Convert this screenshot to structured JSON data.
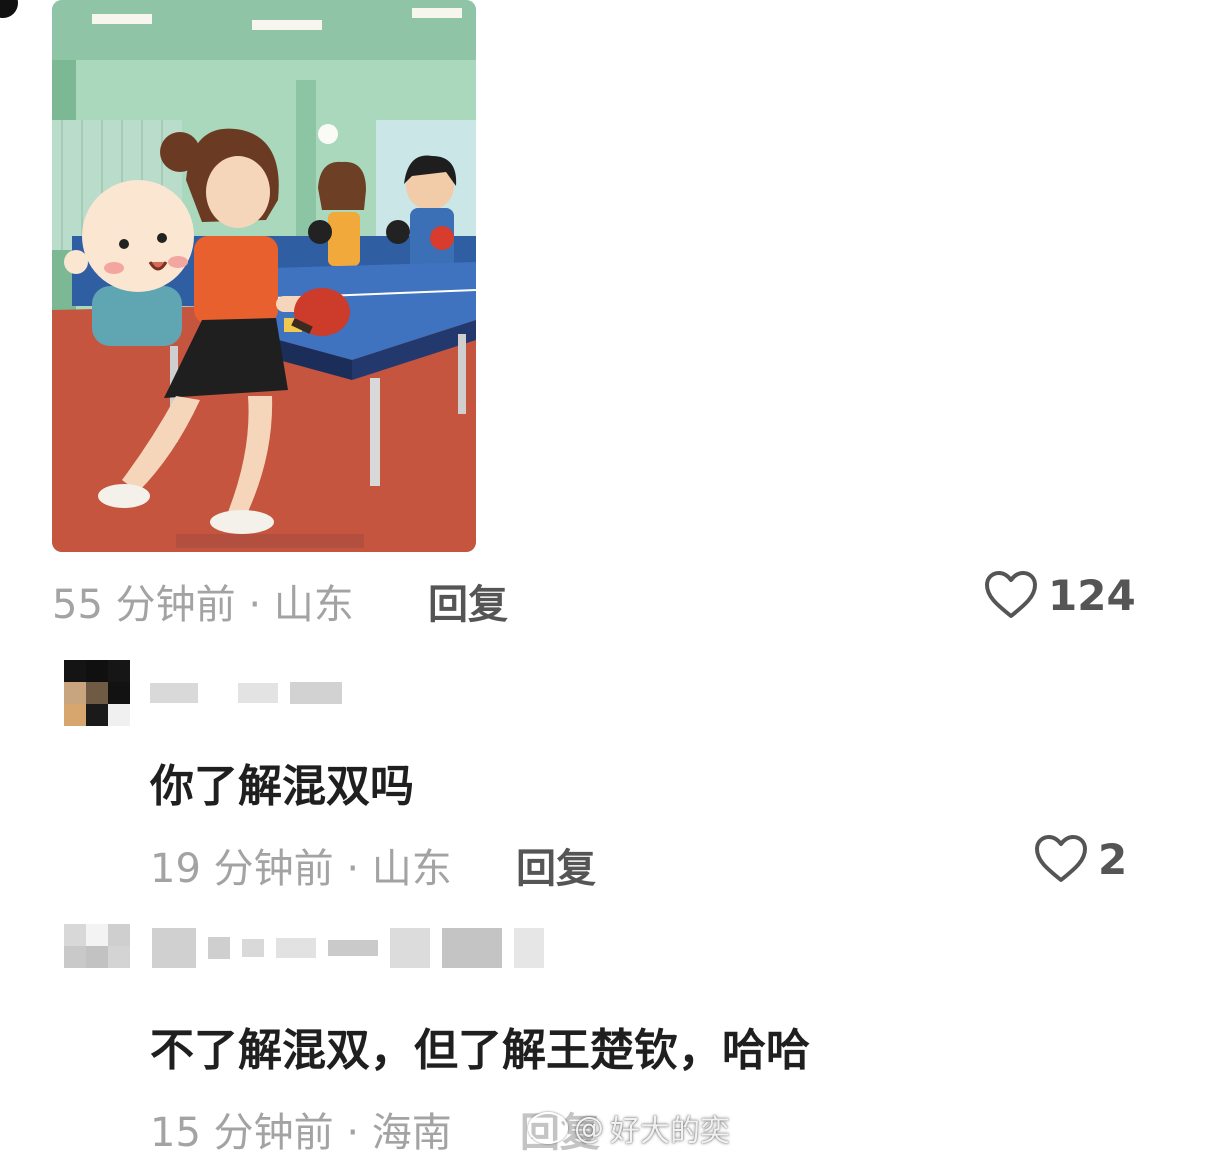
{
  "comments": [
    {
      "has_image": true,
      "image_caption": "",
      "time": "55 分钟前",
      "region": "山东",
      "separator": "·",
      "reply_label": "回复",
      "likes": "124"
    },
    {
      "author": "",
      "text": "你了解混双吗",
      "time": "19 分钟前",
      "region": "山东",
      "separator": "·",
      "reply_label": "回复",
      "likes": "2"
    },
    {
      "author": "",
      "text": "不了解混双，但了解王楚钦，哈哈",
      "time": "15 分钟前",
      "region": "海南",
      "separator": "·",
      "reply_label": "回复"
    }
  ],
  "watermark": {
    "prefix": "@",
    "handle": "好大的奕"
  },
  "icons": {
    "like": "heart-outline-icon",
    "watermark": "weibo-logo-icon"
  },
  "colors": {
    "meta": "#a3a3a3",
    "reply": "#555555",
    "text": "#1f1f1f"
  }
}
